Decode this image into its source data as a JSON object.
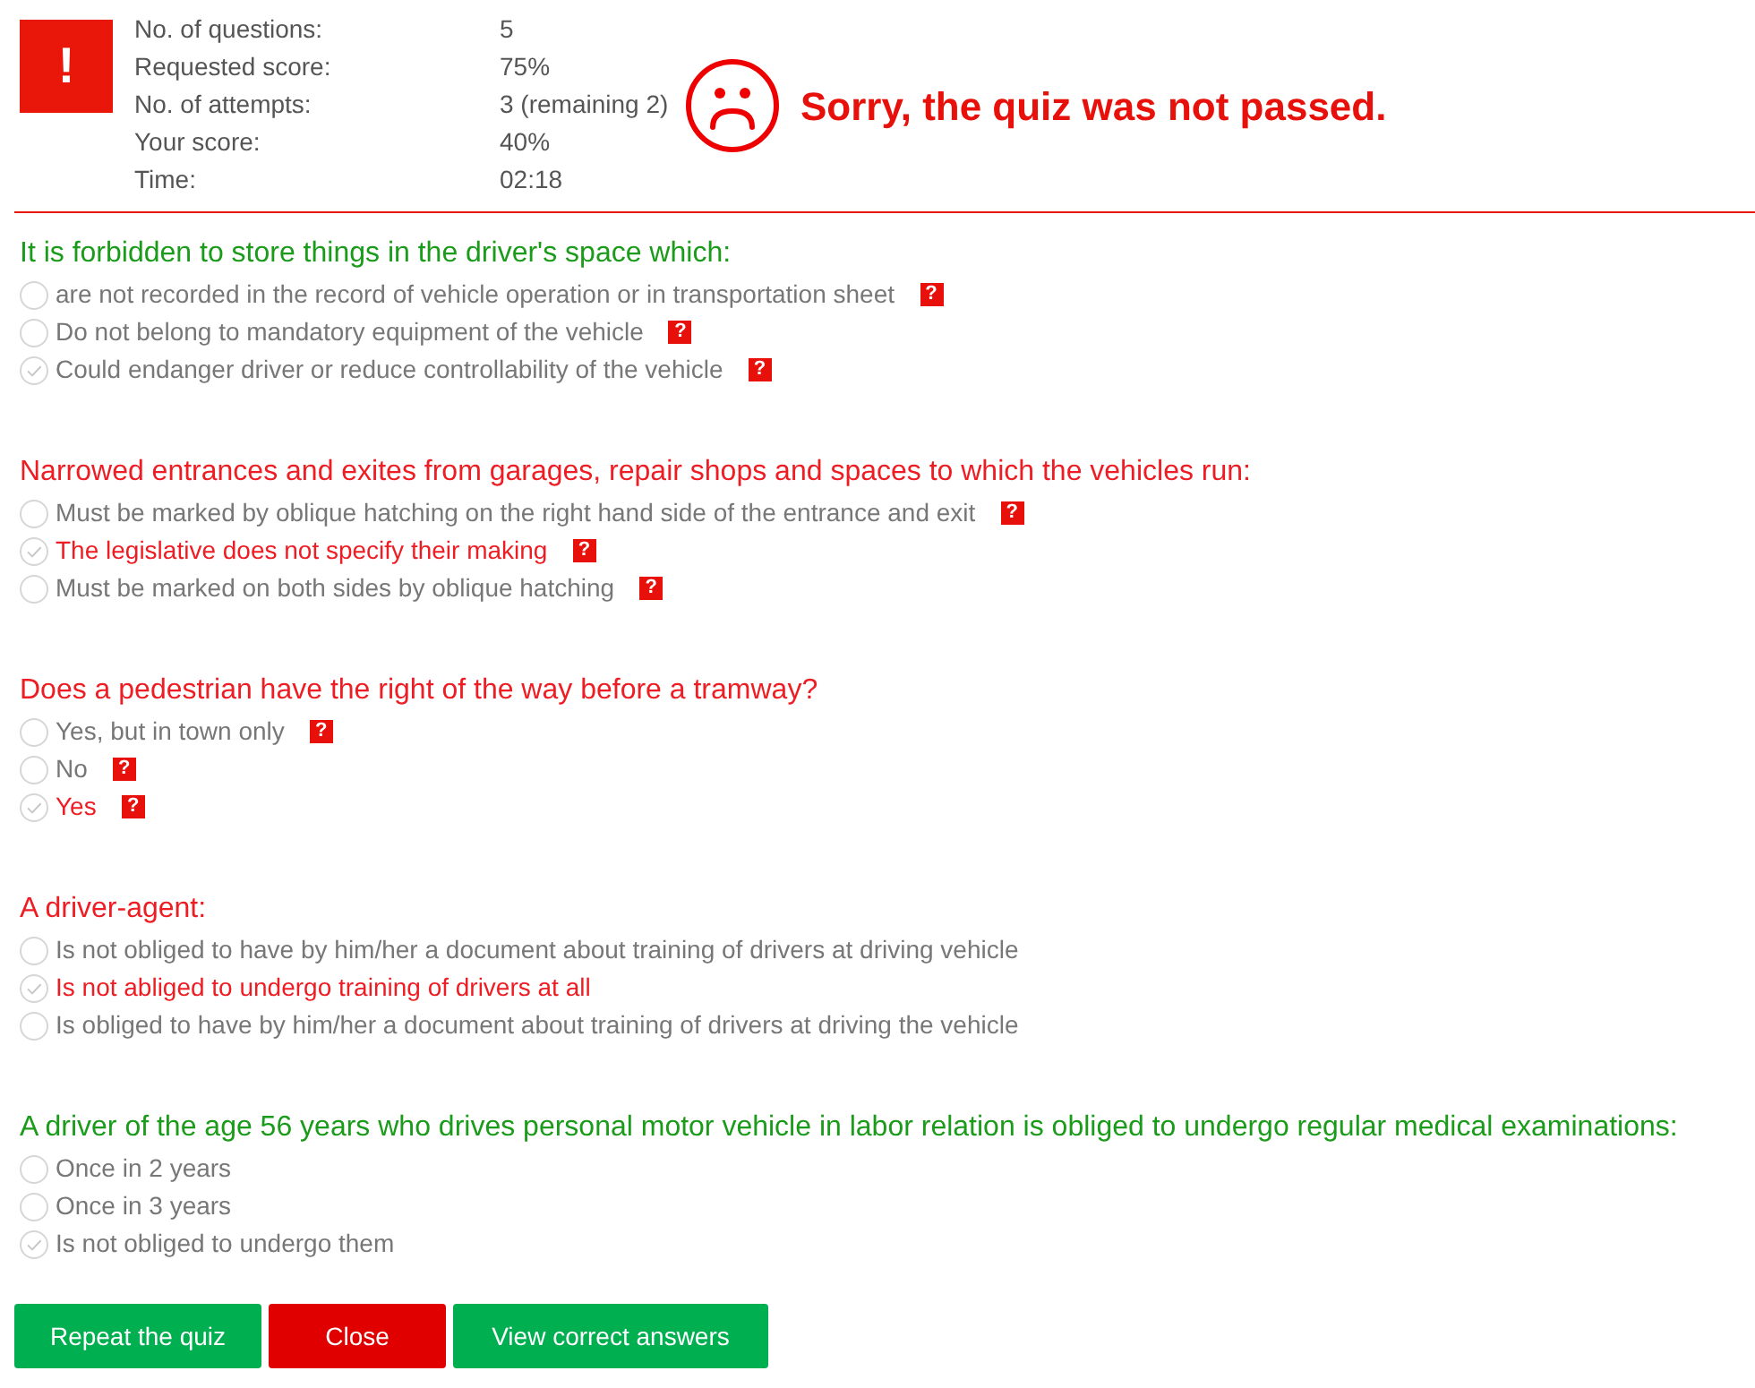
{
  "summary": {
    "alert_mark": "!",
    "stats": [
      {
        "label": "No. of questions:",
        "value": "5"
      },
      {
        "label": "Requested score:",
        "value": "75%"
      },
      {
        "label": "No. of attempts:",
        "value": "3 (remaining 2)"
      },
      {
        "label": "Your score:",
        "value": "40%"
      },
      {
        "label": "Time:",
        "value": "02:18"
      }
    ],
    "passed": false,
    "message": "Sorry, the quiz was not passed."
  },
  "questions": [
    {
      "text": "It is forbidden to store things in the driver's space which:",
      "correct": true,
      "answers": [
        {
          "text": "are not recorded in the record of vehicle operation or in transportation sheet",
          "selected": false,
          "hint_mark": "?"
        },
        {
          "text": "Do not belong to mandatory equipment of the vehicle",
          "selected": false,
          "hint_mark": "?"
        },
        {
          "text": "Could endanger driver or reduce controllability of the vehicle",
          "selected": true,
          "hint_mark": "?"
        }
      ]
    },
    {
      "text": "Narrowed entrances and exites from garages, repair shops and spaces to which the vehicles run:",
      "correct": false,
      "answers": [
        {
          "text": "Must be marked by oblique hatching on the right hand side of the entrance and exit",
          "selected": false,
          "hint_mark": "?"
        },
        {
          "text": "The legislative does not specify their making",
          "selected": true,
          "hint_mark": "?"
        },
        {
          "text": "Must be marked on both sides by oblique hatching",
          "selected": false,
          "hint_mark": "?"
        }
      ]
    },
    {
      "text": "Does a pedestrian have the right of the way before a tramway?",
      "correct": false,
      "answers": [
        {
          "text": "Yes, but in town only",
          "selected": false,
          "hint_mark": "?"
        },
        {
          "text": "No",
          "selected": false,
          "hint_mark": "?"
        },
        {
          "text": "Yes",
          "selected": true,
          "hint_mark": "?"
        }
      ]
    },
    {
      "text": "A driver-agent:",
      "correct": false,
      "answers": [
        {
          "text": "Is not obliged to have by him/her a document about training of drivers at driving vehicle",
          "selected": false
        },
        {
          "text": "Is not abliged to undergo training of drivers at all",
          "selected": true
        },
        {
          "text": "Is obliged to have by him/her a document about training of drivers at driving the vehicle",
          "selected": false
        }
      ]
    },
    {
      "text": "A driver of the age 56 years who drives personal motor vehicle in labor relation is obliged to undergo regular medical examinations:",
      "correct": true,
      "answers": [
        {
          "text": "Once in 2 years",
          "selected": false
        },
        {
          "text": "Once in 3 years",
          "selected": false
        },
        {
          "text": "Is not obliged to undergo them",
          "selected": true
        }
      ]
    }
  ],
  "buttons": [
    {
      "label": "Repeat the quiz",
      "kind": "primary"
    },
    {
      "label": "Close",
      "kind": "danger"
    },
    {
      "label": "View correct answers",
      "kind": "primary"
    }
  ]
}
